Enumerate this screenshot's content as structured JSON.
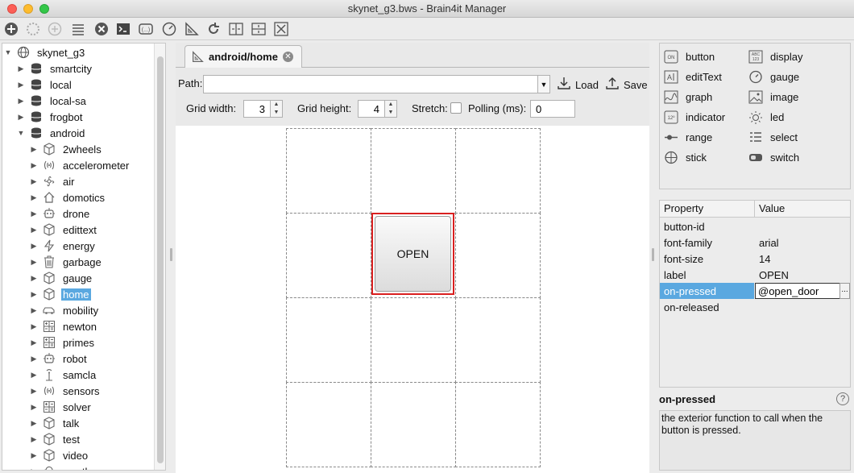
{
  "window": {
    "title": "skynet_g3.bws - Brain4it Manager",
    "traffic_lights": [
      "#fc5f57",
      "#fdbc2e",
      "#33c748"
    ]
  },
  "toolbar": {
    "buttons": [
      "add-icon",
      "star-icon",
      "add-disabled-icon",
      "list-icon",
      "stop-icon",
      "terminal-icon",
      "function-icon",
      "gauge-icon",
      "set-square-icon",
      "refresh-icon",
      "split-horizontal-icon",
      "split-vertical-icon",
      "close-box-icon"
    ]
  },
  "tree": {
    "root": {
      "label": "skynet_g3",
      "icon": "globe-icon"
    },
    "modules": [
      {
        "label": "smartcity",
        "icon": "database-icon",
        "expanded": false
      },
      {
        "label": "local",
        "icon": "database-icon",
        "expanded": false
      },
      {
        "label": "local-sa",
        "icon": "database-icon",
        "expanded": false
      },
      {
        "label": "frogbot",
        "icon": "database-icon",
        "expanded": false
      },
      {
        "label": "android",
        "icon": "database-icon",
        "expanded": true
      }
    ],
    "children": [
      {
        "label": "2wheels",
        "icon": "cube-icon"
      },
      {
        "label": "accelerometer",
        "icon": "signal-icon"
      },
      {
        "label": "air",
        "icon": "fan-icon"
      },
      {
        "label": "domotics",
        "icon": "house-icon"
      },
      {
        "label": "drone",
        "icon": "robot-icon"
      },
      {
        "label": "edittext",
        "icon": "cube-icon"
      },
      {
        "label": "energy",
        "icon": "lightning-icon"
      },
      {
        "label": "garbage",
        "icon": "trash-icon"
      },
      {
        "label": "gauge",
        "icon": "cube-icon"
      },
      {
        "label": "home",
        "icon": "cube-icon",
        "selected": true
      },
      {
        "label": "mobility",
        "icon": "car-icon"
      },
      {
        "label": "newton",
        "icon": "calculator-icon"
      },
      {
        "label": "primes",
        "icon": "calculator-icon"
      },
      {
        "label": "robot",
        "icon": "robot-icon"
      },
      {
        "label": "samcla",
        "icon": "antenna-icon"
      },
      {
        "label": "sensors",
        "icon": "signal-icon"
      },
      {
        "label": "solver",
        "icon": "calculator-icon"
      },
      {
        "label": "talk",
        "icon": "cube-icon"
      },
      {
        "label": "test",
        "icon": "cube-icon"
      },
      {
        "label": "video",
        "icon": "cube-icon"
      },
      {
        "label": "weather",
        "icon": "cloud-icon"
      }
    ]
  },
  "editor": {
    "tab_label": "android/home",
    "path_label": "Path:",
    "path_value": "",
    "load_label": "Load",
    "save_label": "Save",
    "grid_width_label": "Grid width:",
    "grid_width": "3",
    "grid_height_label": "Grid height:",
    "grid_height": "4",
    "stretch_label": "Stretch:",
    "stretch_checked": false,
    "polling_label": "Polling (ms):",
    "polling_value": "0",
    "widget_label": "OPEN",
    "selection_color": "#d92020"
  },
  "palette": {
    "items": [
      {
        "label": "button",
        "icon": "button-icon"
      },
      {
        "label": "display",
        "icon": "display-icon"
      },
      {
        "label": "editText",
        "icon": "edittext-icon"
      },
      {
        "label": "gauge",
        "icon": "gauge-icon"
      },
      {
        "label": "graph",
        "icon": "graph-icon"
      },
      {
        "label": "image",
        "icon": "image-icon"
      },
      {
        "label": "indicator",
        "icon": "indicator-icon"
      },
      {
        "label": "led",
        "icon": "led-icon"
      },
      {
        "label": "range",
        "icon": "range-icon"
      },
      {
        "label": "select",
        "icon": "select-icon"
      },
      {
        "label": "stick",
        "icon": "stick-icon"
      },
      {
        "label": "switch",
        "icon": "switch-icon"
      }
    ]
  },
  "properties": {
    "col_property": "Property",
    "col_value": "Value",
    "rows": [
      {
        "key": "button-id",
        "value": ""
      },
      {
        "key": "font-family",
        "value": "arial"
      },
      {
        "key": "font-size",
        "value": "14"
      },
      {
        "key": "label",
        "value": "OPEN"
      },
      {
        "key": "on-pressed",
        "value": "@open_door",
        "selected": true
      },
      {
        "key": "on-released",
        "value": ""
      }
    ],
    "editor_button": "..."
  },
  "help": {
    "title": "on-pressed",
    "question": "?",
    "text": "the exterior function to call when the button is pressed."
  },
  "colors": {
    "selection": "#5aa8e0",
    "accent_red": "#d92020"
  }
}
